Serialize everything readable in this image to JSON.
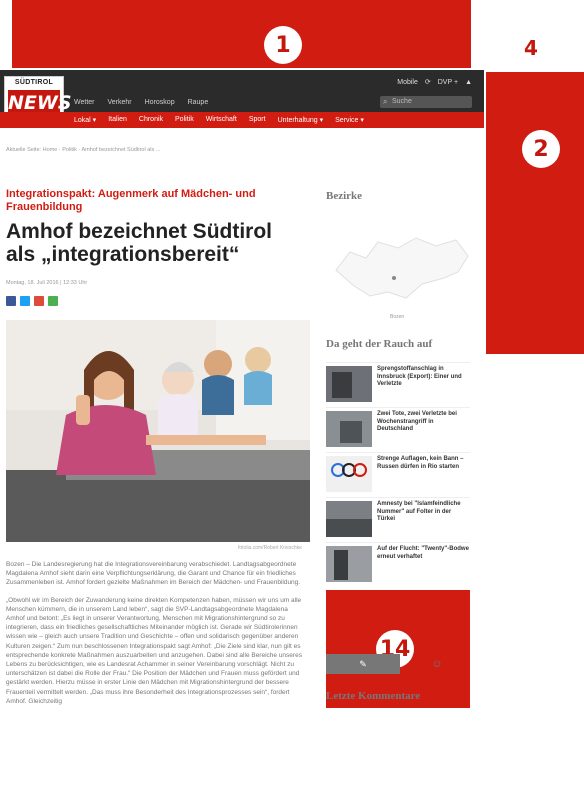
{
  "ads": {
    "ad1_number": "1",
    "ad2_number": "2",
    "ad4_number": "4",
    "ad14_number": "14",
    "color": "#d11c12"
  },
  "header": {
    "logo_top": "SÜDTIROL",
    "logo_main": "NEWS",
    "top_nav": [
      "Wetter",
      "Verkehr",
      "Horoskop",
      "Raupe"
    ],
    "top_links": [
      "Mobile",
      "DVP +"
    ],
    "search_placeholder": "Suche",
    "red_nav": [
      "Lokal ▾",
      "Italien",
      "Chronik",
      "Politik",
      "Wirtschaft",
      "Sport",
      "Unterhaltung ▾",
      "Service ▾"
    ]
  },
  "breadcrumb": "Aktuelle Seite: Home · Politik · Amhof bezeichnet Südtirol als ...",
  "article": {
    "kicker": "Integrationspakt: Augenmerk auf Mädchen- und Frauenbildung",
    "headline": "Amhof bezeichnet Südtirol als „integrationsbereit“",
    "date": "Montag, 18. Juli 2016 | 12:33 Uhr",
    "caption": "fotolia.com/Robert Kneschke",
    "paragraphs": [
      "Bozen – Die Landesregierung hat die Integrationsvereinbarung verabschiedet. Landtagsabgeordnete Magdalena Amhof sieht darin eine Verpflichtungserklärung, die Garant und Chance für ein friedliches Zusammenleben ist. Amhof fordert gezielte Maßnahmen im Bereich der Mädchen- und Frauenbildung.",
      "„Obwohl wir im Bereich der Zuwanderung keine direkten Kompetenzen haben, müssen wir uns um alle Menschen kümmern, die in unserem Land leben“, sagt die SVP-Landtagsabgeordnete Magdalena Amhof und betont: „Es liegt in unserer Verantwortung, Menschen mit Migrationshintergrund so zu integrieren, dass ein friedliches gesellschaftliches Miteinander möglich ist. Gerade wir Südtirolerinnen wissen wie – gleich auch unsere Tradition und Geschichte – offen und solidarisch gegenüber anderen Kulturen zeigen.“ Zum nun beschlossenen Integrationspakt sagt Amhof: „Die Ziele sind klar, nun gilt es entsprechende konkrete Maßnahmen auszuarbeiten und anzugehen. Dabei sind alle Bereiche unseres Lebens zu berücksichtigen, wie es Landesrat Achammer in seiner Vereinbarung vorschlägt. Nicht zu unterschätzen ist dabei die Rolle der Frau.“ Die Position der Mädchen und Frauen muss gefördert und gestärkt werden. Hierzu müsse in erster Linie den Mädchen mit Migrationshintergrund der bessere Frauenteil vermittelt werden. „Das muss ihre Besonderheit des Integrationsprozesses sein“, fordert Amhof. Gleichzeitig"
    ]
  },
  "sidebar": {
    "districts_heading": "Bezirke",
    "map_caption": "Bozen",
    "news_heading": "Da geht der Rauch auf",
    "news": [
      {
        "title": "Sprengstoffanschlag in Innsbruck (Export): Einer und Verletzte"
      },
      {
        "title": "Zwei Tote, zwei Verletzte bei Wochenstrangriff in Deutschland"
      },
      {
        "title": "Strenge Auflagen, kein Bann – Russen dürfen in Rio starten"
      },
      {
        "title": "Amnesty bei \"Islamfeindliche Nummer\" auf Folter in der Türkei"
      },
      {
        "title": "Auf der Flucht: \"Twenty\"-Bodwe erneut verhaftet"
      }
    ],
    "comments_heading": "Letzte Kommentare"
  }
}
